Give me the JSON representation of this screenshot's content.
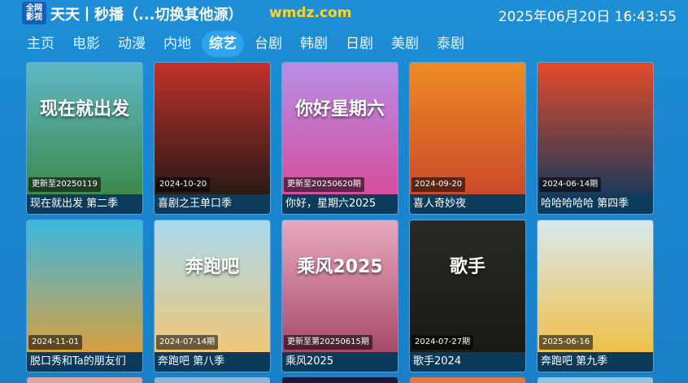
{
  "header": {
    "logo_line1": "全网",
    "logo_line2": "影视",
    "title": "天天丨秒播（...切换其他源）",
    "site": "wmdz.com",
    "datetime": "2025年06月20日 16:43:55"
  },
  "nav": {
    "tabs": [
      {
        "label": "主页"
      },
      {
        "label": "电影"
      },
      {
        "label": "动漫"
      },
      {
        "label": "内地"
      },
      {
        "label": "综艺",
        "active": true
      },
      {
        "label": "台剧"
      },
      {
        "label": "韩剧"
      },
      {
        "label": "日剧"
      },
      {
        "label": "美剧"
      },
      {
        "label": "泰剧"
      }
    ]
  },
  "cards": [
    {
      "title": "现在就出发 第二季",
      "badge": "更新至20250119",
      "art": "现在就出发",
      "color_top": "#5fb8c8",
      "color_bottom": "#3d8a4a"
    },
    {
      "title": "喜剧之王单口季",
      "badge": "2024-10-20",
      "art": "",
      "color_top": "#c0322b",
      "color_bottom": "#2a1a16"
    },
    {
      "title": "你好，星期六2025",
      "badge": "更新至20250620期",
      "art": "你好星期六",
      "color_top": "#b98ee8",
      "color_bottom": "#d64d9c"
    },
    {
      "title": "喜人奇妙夜",
      "badge": "2024-09-20",
      "art": "",
      "color_top": "#f08a24",
      "color_bottom": "#c94a2a"
    },
    {
      "title": "哈哈哈哈哈 第四季",
      "badge": "2024-06-14期",
      "art": "",
      "color_top": "#e64a2a",
      "color_bottom": "#1d3a5a"
    },
    {
      "title": "脱口秀和Ta的朋友们",
      "badge": "2024-11-01",
      "art": "",
      "color_top": "#3ab8e0",
      "color_bottom": "#d8a040"
    },
    {
      "title": "奔跑吧 第八季",
      "badge": "2024-07-14期",
      "art": "奔跑吧",
      "color_top": "#a8d8ee",
      "color_bottom": "#f0c878"
    },
    {
      "title": "乘风2025",
      "badge": "更新至第20250615期",
      "art": "乘风2025",
      "color_top": "#e8a8c0",
      "color_bottom": "#a84a6a"
    },
    {
      "title": "歌手2024",
      "badge": "2024-07-27期",
      "art": "歌手",
      "color_top": "#2a2a24",
      "color_bottom": "#1a1a14"
    },
    {
      "title": "奔跑吧 第九季",
      "badge": "2025-06-16",
      "art": "",
      "color_top": "#d8e8f0",
      "color_bottom": "#f0c048"
    }
  ],
  "peek_colors": [
    "#d8a8a0",
    "#88b8d8",
    "#1a1a3a",
    "#e07848",
    "#88c8e0"
  ]
}
